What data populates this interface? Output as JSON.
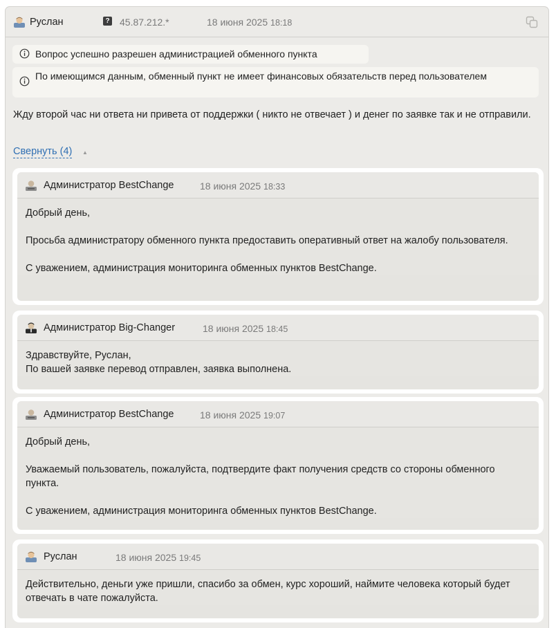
{
  "post": {
    "author": "Руслан",
    "ip": "45.87.212.*",
    "date": "18 июня 2025",
    "time": "18:18",
    "notices": [
      "Вопрос успешно разрешен администрацией обменного пункта",
      "По имеющимся данным, обменный пункт не имеет финансовых обязательств перед пользователем"
    ],
    "text": "Жду второй час ни ответа ни привета от поддержки ( никто не отвечает ) и денег по заявке так и не отправили.",
    "collapse_label": "Свернуть (4)"
  },
  "replies": [
    {
      "author": "Администратор BestChange",
      "date": "18 июня 2025",
      "time": "18:33",
      "lines": [
        "Добрый день,",
        "Просьба администратору обменного пункта предоставить оперативный ответ на жалобу пользователя.",
        "С уважением, администрация мониторинга обменных пунктов BestChange."
      ]
    },
    {
      "author": "Администратор Big-Changer",
      "date": "18 июня 2025",
      "time": "18:45",
      "lines": [
        "Здравствуйте, Руслан,",
        "По вашей заявке перевод отправлен, заявка выполнена."
      ]
    },
    {
      "author": "Администратор BestChange",
      "date": "18 июня 2025",
      "time": "19:07",
      "lines": [
        "Добрый день,",
        "Уважаемый пользователь, пожалуйста, подтвердите факт получения средств со стороны обменного пункта.",
        "С уважением, администрация мониторинга обменных пунктов BestChange."
      ]
    },
    {
      "author": "Руслан",
      "date": "18 июня 2025",
      "time": "19:45",
      "lines": [
        "Действительно, деньги уже пришли, спасибо за обмен, курс хороший, наймите человека который будет отвечать в чате пожалуйста."
      ]
    }
  ],
  "icons": {
    "user": "user-avatar-icon",
    "admin": "admin-avatar-icon",
    "exchanger": "exchanger-admin-icon",
    "ip": "ip-unknown-icon",
    "copy": "copy-icon",
    "info": "info-icon",
    "collapse": "triangle-up-icon"
  },
  "colors": {
    "link": "#2f6fb3",
    "card_bg": "#ecebe8",
    "reply_bg": "#e5e4e0"
  }
}
